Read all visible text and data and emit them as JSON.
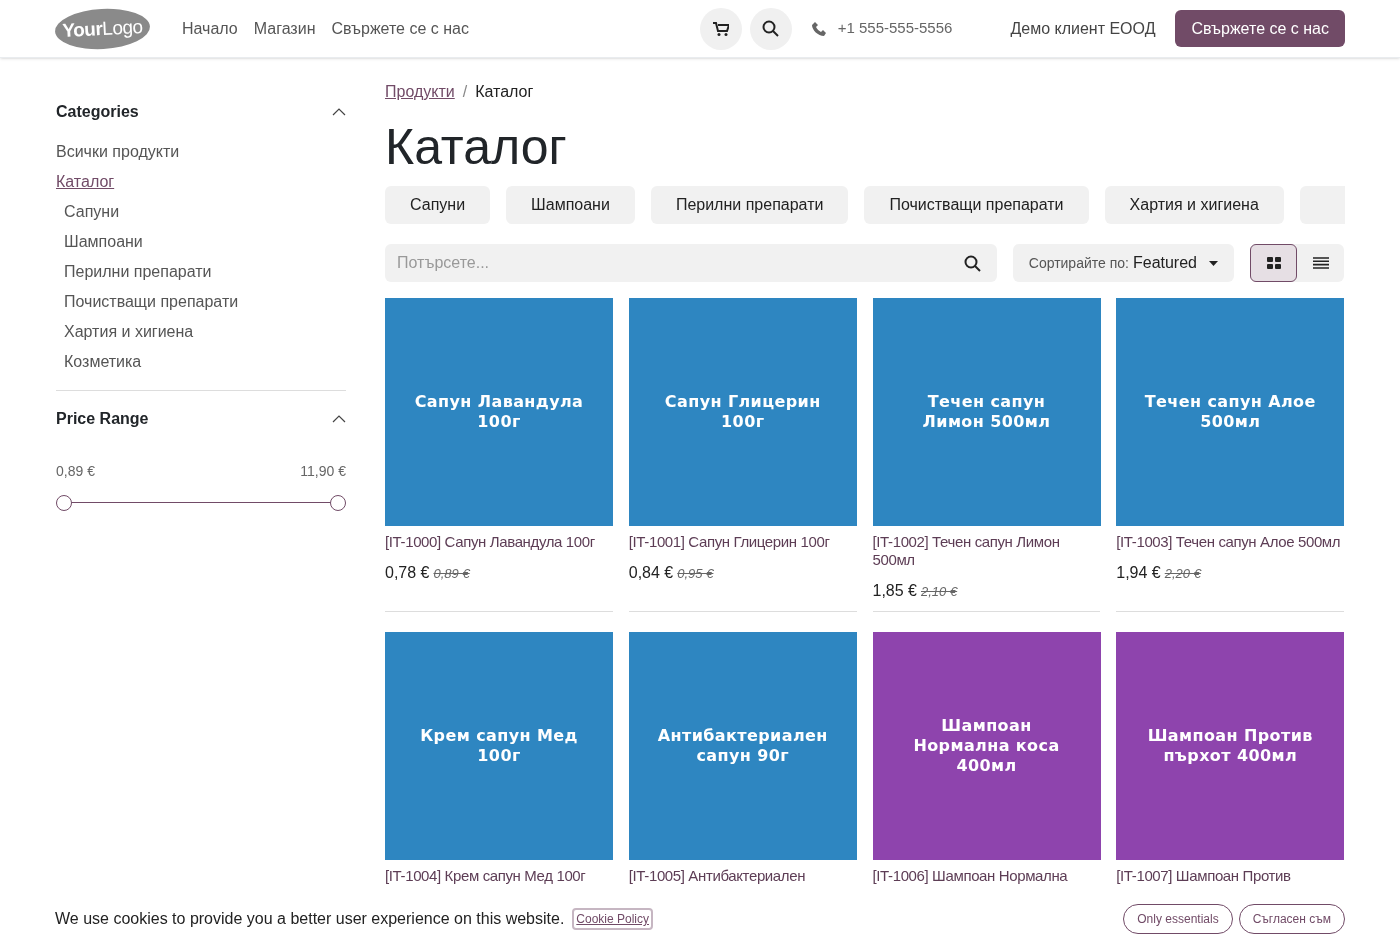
{
  "header": {
    "logo": "**Your**Logo",
    "nav": [
      "Начало",
      "Магазин",
      "Свържете се с нас"
    ],
    "phone": "+1 555-555-5556",
    "account": "Демо клиент ЕООД",
    "cta": "Свържете се с нас"
  },
  "sidebar": {
    "categories": {
      "title": "Categories",
      "expanded": true,
      "items": [
        {
          "label": "Всички продукти",
          "selected": false
        },
        {
          "label": "Каталог",
          "selected": true,
          "children": [
            {
              "label": "Сапуни",
              "selected": false
            },
            {
              "label": "Шампоани",
              "selected": false
            },
            {
              "label": "Перилни препарати",
              "selected": false
            },
            {
              "label": "Почистващи препарати",
              "selected": false
            },
            {
              "label": "Хартия и хигиена",
              "selected": false
            },
            {
              "label": "Козметика",
              "selected": false
            }
          ]
        }
      ]
    },
    "price_range": {
      "title": "Price Range",
      "expanded": true,
      "min": "0,89 €",
      "max": "11,90 €",
      "thumbs": [
        {
          "level": 0
        },
        {
          "level": 1
        }
      ]
    }
  },
  "breadcrumb": [
    {
      "label": "Продукти",
      "link": true
    },
    {
      "label": "Каталог",
      "link": false
    }
  ],
  "breadcrumb_separator": "/",
  "heading": "Каталог",
  "category_buttons": [
    "Сапуни",
    "Шампоани",
    "Перилни препарати",
    "Почистващи препарати",
    "Хартия и хигиена"
  ],
  "search": {
    "placeholder": "Потърсете..."
  },
  "sort": {
    "label": "Сортирайте по:",
    "value": "Featured"
  },
  "view_modes": [
    {
      "kind": "grid",
      "selected": true
    },
    {
      "kind": "list",
      "selected": false
    }
  ],
  "products": [
    {
      "image_label": "Сапун Лавандула 100г",
      "color": "#2e86c1",
      "name": "[IT-1000] Сапун Лавандула 100г",
      "price": "0,78 €",
      "old_price": "0,89 €"
    },
    {
      "image_label": "Сапун Глицерин 100г",
      "color": "#2e86c1",
      "name": "[IT-1001] Сапун Глицерин 100г",
      "price": "0,84 €",
      "old_price": "0,95 €"
    },
    {
      "image_label": "Течен сапун Лимон 500мл",
      "color": "#2e86c1",
      "name": "[IT-1002] Течен сапун Лимон 500мл",
      "price": "1,85 €",
      "old_price": "2,10 €"
    },
    {
      "image_label": "Течен сапун Алое 500мл",
      "color": "#2e86c1",
      "name": "[IT-1003] Течен сапун Алое 500мл",
      "price": "1,94 €",
      "old_price": "2,20 €"
    },
    {
      "image_label": "Крем сапун Мед 100г",
      "color": "#2e86c1",
      "name": "[IT-1004] Крем сапун Мед 100г"
    },
    {
      "image_label": "Антибактериален сапун 90г",
      "color": "#2e86c1",
      "name": "[IT-1005] Антибактериален"
    },
    {
      "image_label": "Шампоан Нормална коса 400мл",
      "color": "#8e44ad",
      "name": "[IT-1006] Шампоан Нормална"
    },
    {
      "image_label": "Шампоан Против пърхот 400мл",
      "color": "#8e44ad",
      "name": "[IT-1007] Шампоан Против"
    }
  ],
  "cookie_bar": {
    "message": "We use cookies to provide you a better user experience on this website.",
    "policy_link": "Cookie Policy",
    "buttons": [
      "Only essentials",
      "Съгласен съм"
    ]
  }
}
